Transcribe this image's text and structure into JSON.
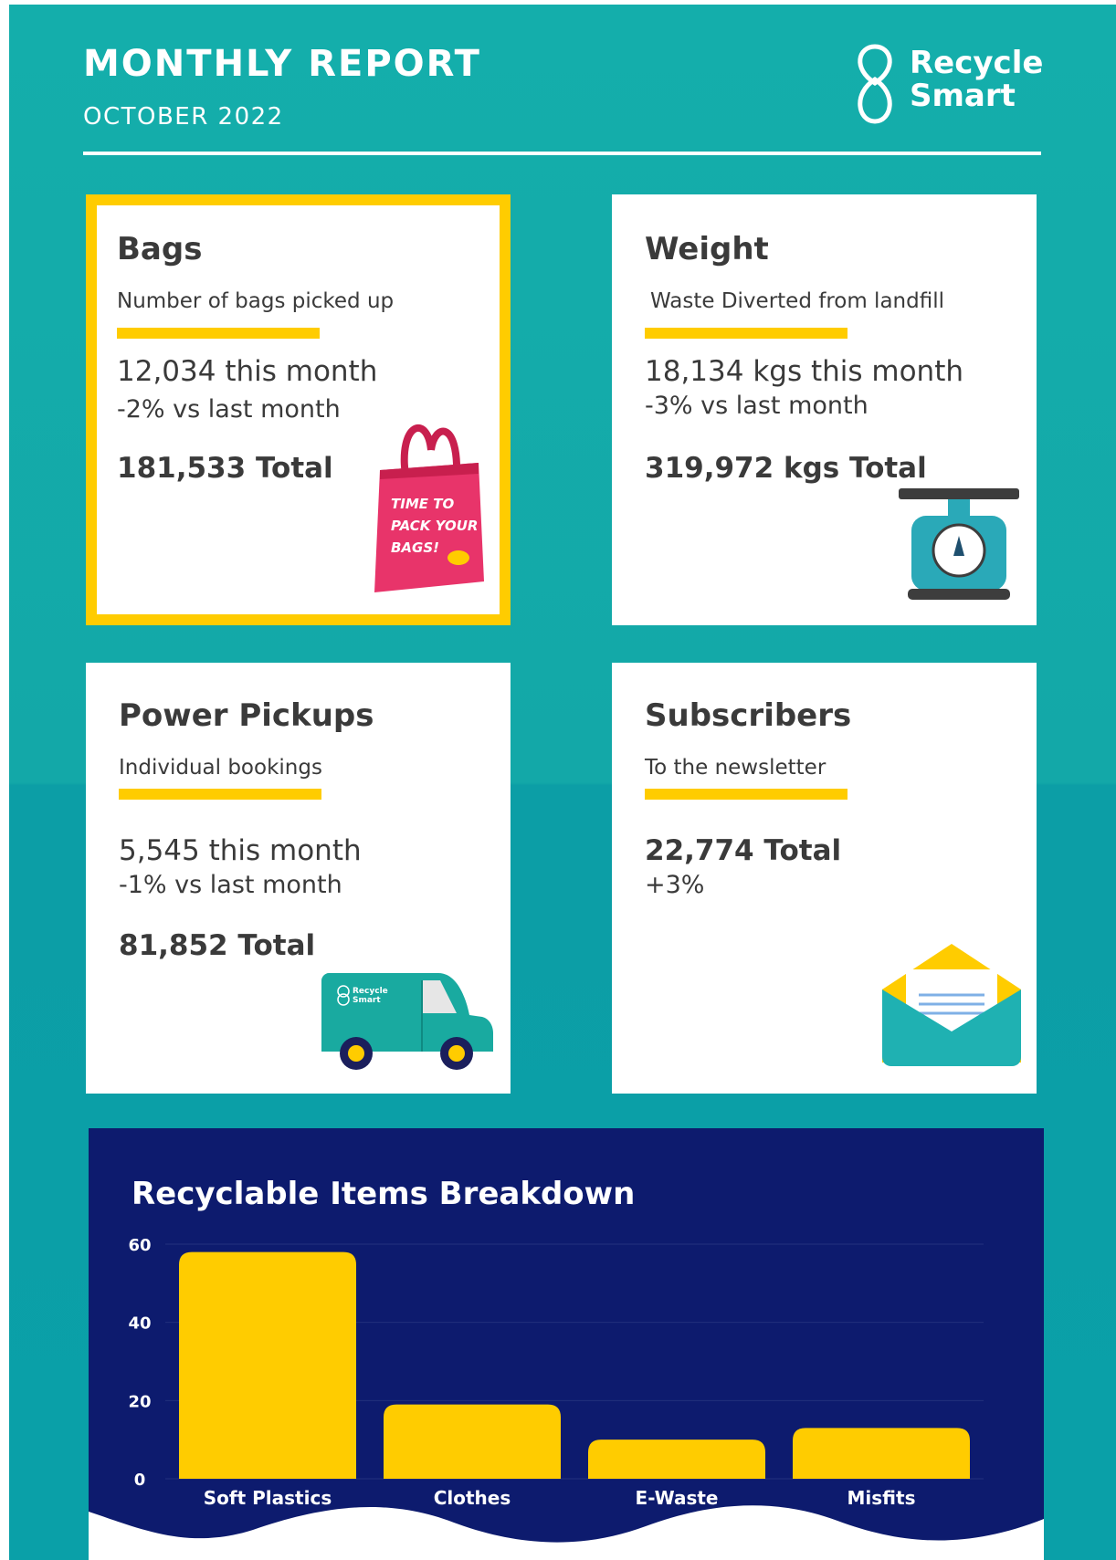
{
  "header": {
    "title": "MONTHLY REPORT",
    "subtitle": "OCTOBER 2022",
    "logo": {
      "line1": "Recycle",
      "line2": "Smart"
    }
  },
  "cards": {
    "bags": {
      "title": "Bags",
      "subtitle": "Number of bags picked up",
      "stat": "12,034 this month",
      "change": "-2% vs last month",
      "total": "181,533 Total",
      "illustration_text": [
        "TIME TO",
        "PACK YOUR",
        "BAGS!"
      ]
    },
    "weight": {
      "title": "Weight",
      "subtitle": "Waste Diverted from landfill",
      "stat": "18,134 kgs this month",
      "change": "-3% vs last month",
      "total": "319,972 kgs Total"
    },
    "pickups": {
      "title": "Power Pickups",
      "subtitle": "Individual bookings",
      "stat": "5,545 this month",
      "change": "-1% vs last month",
      "total": "81,852 Total",
      "van_logo": [
        "Recycle",
        "Smart"
      ]
    },
    "subscribers": {
      "title": "Subscribers",
      "subtitle": "To the newsletter",
      "total": "22,774 Total",
      "change": "+3%"
    }
  },
  "colors": {
    "teal": "#14aeab",
    "yellow": "#ffcc00",
    "navy": "#0d1b6e",
    "bag_pink": "#e8346a",
    "scale_teal": "#2aa9b8"
  },
  "chart_data": {
    "type": "bar",
    "title": "Recyclable Items Breakdown",
    "categories": [
      "Soft Plastics",
      "Clothes",
      "E-Waste",
      "Misfits"
    ],
    "values": [
      58,
      19,
      10,
      13
    ],
    "yticks": [
      0,
      20,
      40,
      60
    ],
    "ylim": [
      0,
      60
    ],
    "xlabel": "",
    "ylabel": "",
    "grid": true
  }
}
